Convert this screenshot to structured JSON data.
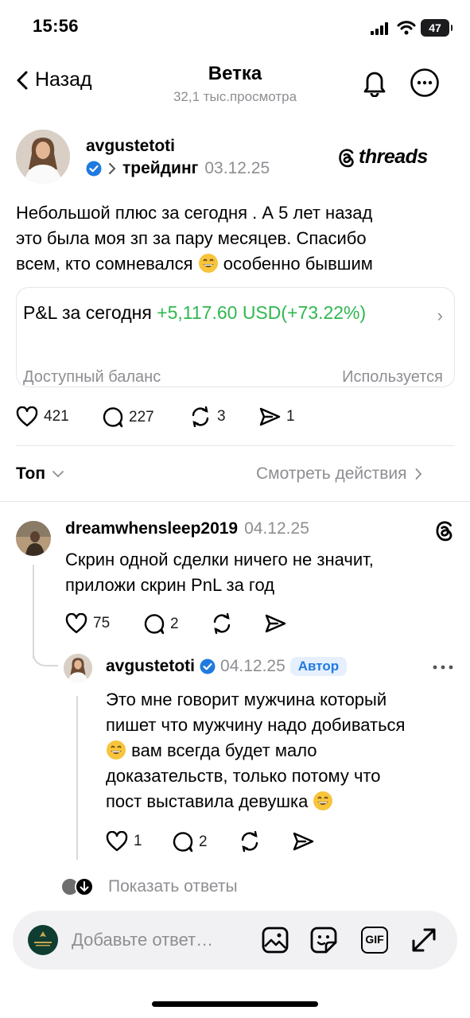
{
  "status_bar": {
    "time": "15:56",
    "battery": "47"
  },
  "header": {
    "back_label": "Назад",
    "title": "Ветка",
    "views": "32,1 тыс.просмотра"
  },
  "post": {
    "username": "avgustetoti",
    "topic": "трейдинг",
    "date": "03.12.25",
    "source_logo": "threads",
    "text_lines": [
      "Небольшой плюс за сегодня . А 5 лет назад",
      "это была моя зп за пару месяцев. Спасибо",
      "всем, кто сомневался",
      "особенно бывшим"
    ],
    "pnl_card": {
      "label": "P&L за сегодня",
      "value": "+5,117.60 USD(+73.22%)",
      "available_balance": "Доступный баланс",
      "in_use": "Используется"
    },
    "stats": {
      "likes": "421",
      "comments": "227",
      "reposts": "3",
      "shares": "1"
    }
  },
  "sort_bar": {
    "sort_label": "Топ",
    "view_actions": "Смотреть действия"
  },
  "comment": {
    "username": "dreamwhensleep2019",
    "date": "04.12.25",
    "text_lines": [
      "Скрин одной сделки ничего не значит,",
      "приложи скрин PnL за год"
    ],
    "stats": {
      "likes": "75",
      "comments": "2"
    }
  },
  "reply": {
    "username": "avgustetoti",
    "date": "04.12.25",
    "badge": "Автор",
    "text_lines": [
      "Это мне говорит мужчина который",
      "пишет что мужчину надо добиваться",
      "вам всегда будет мало",
      "доказательств, только потому что",
      "пост выставила девушка"
    ],
    "stats": {
      "likes": "1",
      "comments": "2"
    }
  },
  "show_replies": "Показать ответы",
  "composer": {
    "placeholder": "Добавьте ответ…",
    "gif_label": "GIF"
  },
  "colors": {
    "green": "#2fb84f",
    "verified": "#1f7ae0",
    "gray": "#8e8e93"
  }
}
